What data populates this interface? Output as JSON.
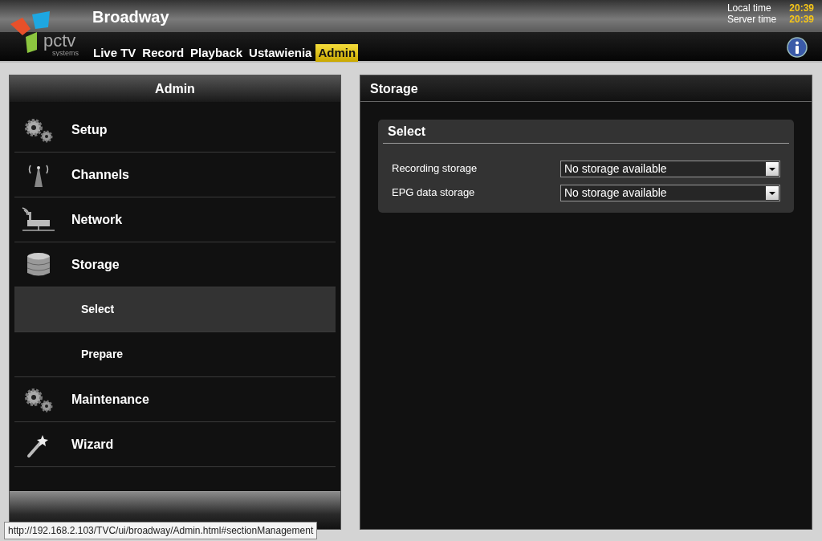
{
  "app": {
    "title": "Broadway",
    "logo_text": "pctv",
    "logo_subtext": "systems"
  },
  "clock": [
    {
      "label": "Local time",
      "value": "20:39"
    },
    {
      "label": "Server time",
      "value": "20:39"
    }
  ],
  "tabs": [
    {
      "label": "Live TV",
      "selected": false
    },
    {
      "label": "Record",
      "selected": false
    },
    {
      "label": "Playback",
      "selected": false
    },
    {
      "label": "Ustawienia",
      "selected": false
    },
    {
      "label": "Admin",
      "selected": true
    }
  ],
  "sidebar": {
    "title": "Admin",
    "items": [
      {
        "label": "Setup",
        "kind": "main",
        "selected": false
      },
      {
        "label": "Channels",
        "kind": "main",
        "selected": false
      },
      {
        "label": "Network",
        "kind": "main",
        "selected": false
      },
      {
        "label": "Storage",
        "kind": "main",
        "selected": false
      },
      {
        "label": "Select",
        "kind": "sub",
        "selected": true
      },
      {
        "label": "Prepare",
        "kind": "sub",
        "selected": false
      },
      {
        "label": "Maintenance",
        "kind": "main",
        "selected": false
      },
      {
        "label": "Wizard",
        "kind": "main",
        "selected": false
      }
    ]
  },
  "content": {
    "title": "Storage",
    "section": {
      "title": "Select",
      "fields": [
        {
          "label": "Recording storage",
          "value": "No storage available"
        },
        {
          "label": "EPG data storage",
          "value": "No storage available"
        }
      ]
    }
  },
  "status_bar": "http://192.168.2.103/TVC/ui/broadway/Admin.html#sectionManagement"
}
